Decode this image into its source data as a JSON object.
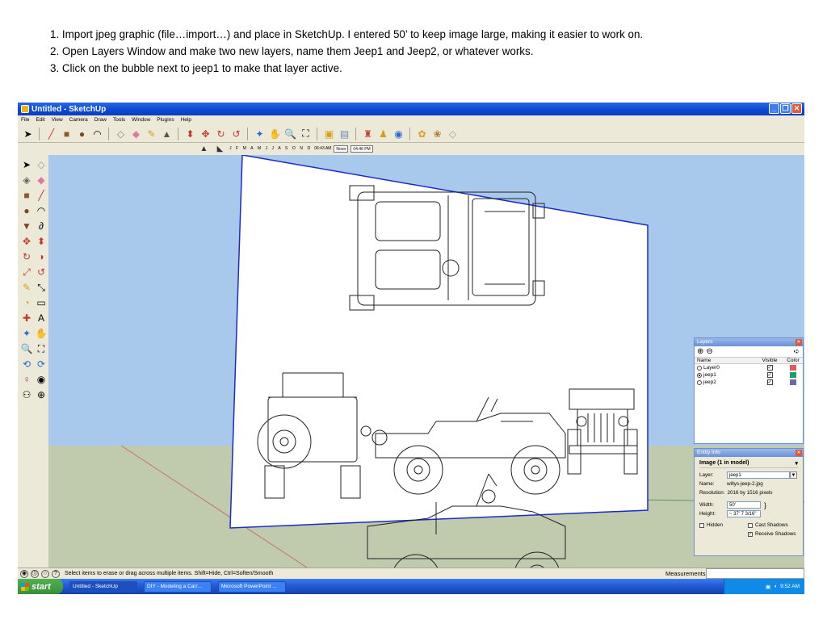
{
  "instructions": [
    "1. Import jpeg graphic (file…import…) and place in SketchUp. I entered 50’ to keep image large, making it easier to work on.",
    "2. Open Layers Window and make two new layers, name them Jeep1 and Jeep2, or whatever works.",
    " 3. Click on the bubble next to jeep1 to make that layer active."
  ],
  "window": {
    "title": "Untitled - SketchUp",
    "menu": [
      "File",
      "Edit",
      "View",
      "Camera",
      "Draw",
      "Tools",
      "Window",
      "Plugins",
      "Help"
    ]
  },
  "shadows": {
    "months": "J F M A M J J A S O N D",
    "time_start": "06:43 AM",
    "noon": "Noon",
    "time_end": "04:46 PM"
  },
  "colors": {
    "sky": "#a4c6ea",
    "ground": "#c2ccb0",
    "image_edge": "#1a2cc8",
    "taskbar": "#245edb"
  },
  "layers_panel": {
    "title": "Layers",
    "col_name": "Name",
    "col_visible": "Visible",
    "col_color": "Color",
    "layers": [
      {
        "name": "Layer0",
        "active": false,
        "visible": true,
        "color": "#e05a5a"
      },
      {
        "name": "jeep1",
        "active": true,
        "visible": true,
        "color": "#1aa06a"
      },
      {
        "name": "jeep2",
        "active": false,
        "visible": true,
        "color": "#6a6aa8"
      }
    ]
  },
  "entity_info": {
    "title": "Entity Info",
    "heading": "Image (1 in model)",
    "layer_label": "Layer:",
    "layer_value": "jeep1",
    "name_label": "Name:",
    "name_value": "willys-jeep-2.jpg",
    "resolution_label": "Resolution:",
    "resolution_value": "2016 by 1516 pixels",
    "width_label": "Width:",
    "width_value": "50'",
    "height_label": "Height:",
    "height_value": "~ 37' 7 3/16\"",
    "hidden_label": "Hidden",
    "cast_shadows_label": "Cast Shadows",
    "receive_shadows_label": "Receive Shadows"
  },
  "status": {
    "text": "Select items to erase or drag across multiple items. Shift=Hide, Ctrl=Soften/Smooth",
    "measurements_label": "Measurements"
  },
  "taskbar": {
    "start": "start",
    "tasks": [
      "Untitled - SketchUp",
      "DIY - Modeling a Car/...",
      "Microsoft PowerPoint ..."
    ],
    "clock": "9:52 AM"
  }
}
